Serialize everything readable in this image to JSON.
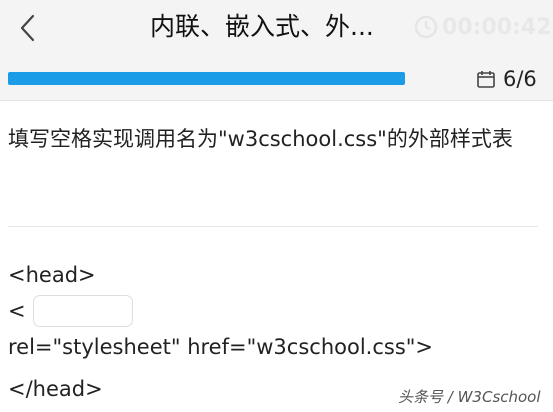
{
  "header": {
    "title": "内联、嵌入式、外...",
    "timer": "00:00:42"
  },
  "progress": {
    "fraction": 1.0,
    "counter": "6/6"
  },
  "question": {
    "text": "填写空格实现调用名为\"w3cschool.css\"的外部样式表"
  },
  "code": {
    "line1": "<head>",
    "line2_prefix": "<",
    "line3": "rel=\"stylesheet\" href=\"w3cschool.css\">",
    "line4": "</head>"
  },
  "blank": {
    "value": "",
    "placeholder": ""
  },
  "watermark": "头条号 / W3Cschool",
  "colors": {
    "accent": "#1a9de6",
    "header_bg": "#f4f4f4"
  },
  "icons": {
    "back": "chevron-left-icon",
    "timer": "clock-icon",
    "counter": "calendar-icon"
  }
}
